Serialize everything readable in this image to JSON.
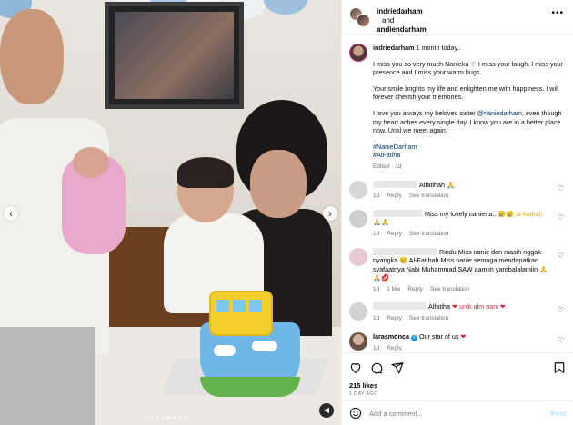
{
  "header": {
    "user1": "indriedarham",
    "conj": "and",
    "user2": "andiendarham"
  },
  "caption": {
    "author": "indriedarham",
    "time_suffix": "1 month today..",
    "p1": "I miss you so very much Nanieku ♡ I miss your laugh. I miss your presence and I miss your warm hugs.",
    "p2": "Your smile brights my life and enlighten me with happiness. I will forever cherish your memories.",
    "p3_a": "I love you always my beloved sister ",
    "p3_mention": "@naniedarham",
    "p3_b": ", even though my heart aches every single day. I know you are in a better place now. Until we meet again.",
    "tag1": "#NanieDarham",
    "tag2": "#AlFatiha",
    "meta": "Edited · 1d"
  },
  "comments": [
    {
      "text": "Alfatihah",
      "emoji": "🙏",
      "time": "1d",
      "reply": "Reply",
      "translation": "See translation"
    },
    {
      "text": "Miss my lovely naniena..",
      "emoji": "😢😢 al-fatihah 🙏🙏",
      "time": "1d",
      "reply": "Reply",
      "translation": "See translation"
    },
    {
      "text": "Rindu Miss nanie dan masih nggak nyangka 😢 Al-Fatihah Miss nanie semoga mendapatkan syafaatnya Nabi Muhammad SAW aamiin yarobalalamiin 🙏🙏💋",
      "time": "1d",
      "likes": "1 like",
      "reply": "Reply",
      "translation": "See translation"
    },
    {
      "text": "Alfatiha",
      "emoji": "❤ untk alm nani ❤",
      "time": "1d",
      "reply": "Reply",
      "translation": "See translation"
    },
    {
      "user": "larasmonca",
      "text": "Our star of us",
      "emoji": "❤",
      "time": "1d",
      "reply": "Reply"
    }
  ],
  "actions": {
    "likes": "215 likes",
    "ago": "1 DAY AGO"
  },
  "add_comment": {
    "placeholder": "Add a comment...",
    "post": "Post"
  },
  "icons": [
    "more-icon",
    "chevron-left-icon",
    "chevron-right-icon",
    "mute-icon",
    "heart-icon",
    "comment-icon",
    "share-icon",
    "bookmark-icon",
    "emoji-icon"
  ],
  "colors": {
    "link": "#00376b",
    "muted": "#737373",
    "post": "#b2dffc",
    "story_ring": "#c8358d"
  }
}
